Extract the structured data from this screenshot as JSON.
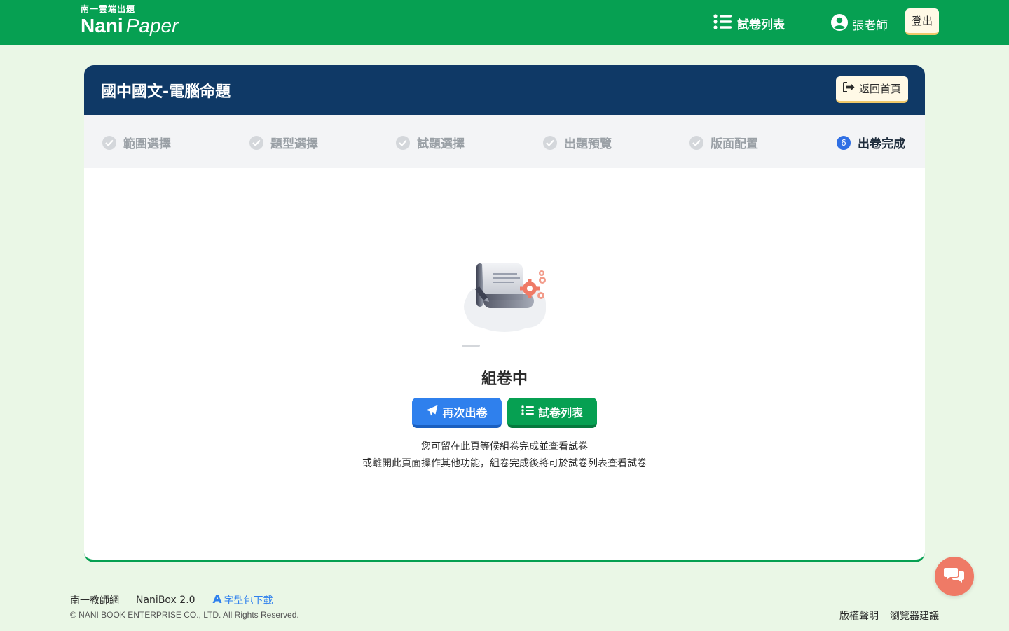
{
  "brand": {
    "sub": "南一雲端出題",
    "name_bold": "Nani",
    "name_italic": "Paper"
  },
  "nav": {
    "paper_list": "試卷列表",
    "user": "張老師",
    "logout": "登出"
  },
  "card": {
    "title": "國中國文-電腦命題",
    "back_label": "返回首頁"
  },
  "steps": [
    {
      "label": "範圍選擇",
      "state": "done"
    },
    {
      "label": "題型選擇",
      "state": "done"
    },
    {
      "label": "試題選擇",
      "state": "done"
    },
    {
      "label": "出題預覽",
      "state": "done"
    },
    {
      "label": "版面配置",
      "state": "done"
    },
    {
      "label": "出卷完成",
      "state": "active",
      "number": "6"
    }
  ],
  "status": {
    "title": "組卷中",
    "btn_again": "再次出卷",
    "btn_list": "試卷列表",
    "hint_line1": "您可留在此頁等候組卷完成並查看試卷",
    "hint_line2": "或離開此頁面操作其他功能，組卷完成後將可於試卷列表查看試卷"
  },
  "footer": {
    "link1": "南一教師網",
    "link2": "NaniBox 2.0",
    "font_download": "字型包下載",
    "copyright": "© NANI BOOK ENTERPRISE CO., LTD. All Rights Reserved.",
    "copyright_notice": "版權聲明",
    "browser_suggestion": "瀏覽器建議"
  },
  "colors": {
    "primary_green": "#06a052",
    "header_navy": "#0f3966",
    "accent_blue": "#2f80ed",
    "chat_coral": "#ef7a66",
    "page_bg": "#eaf7e6"
  },
  "icons": {
    "list": "list-icon",
    "user": "user-circle-icon",
    "back": "sign-out-icon",
    "check": "check-circle-icon",
    "send": "paper-plane-icon",
    "chat": "chat-bubbles-icon",
    "font": "font-icon"
  }
}
